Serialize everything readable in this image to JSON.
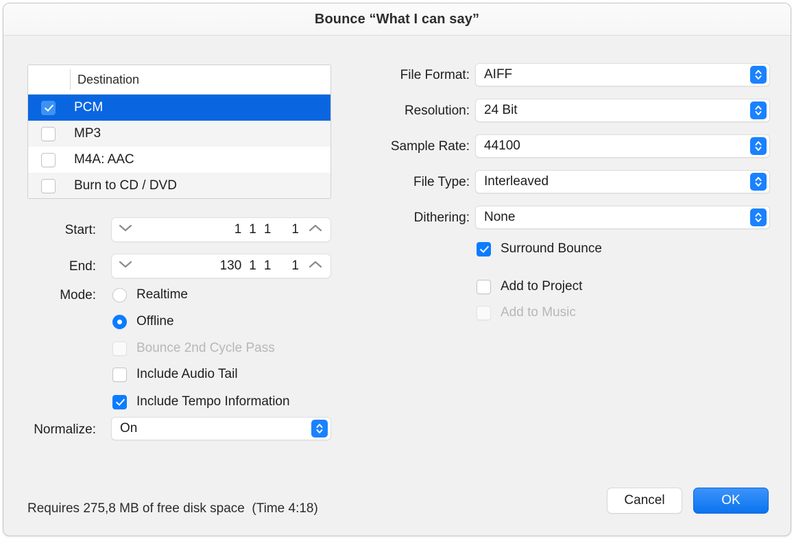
{
  "window": {
    "title": "Bounce “What I can say”"
  },
  "destination": {
    "column_header": "Destination",
    "items": [
      {
        "label": "PCM",
        "checked": true,
        "selected": true
      },
      {
        "label": "MP3",
        "checked": false,
        "selected": false
      },
      {
        "label": "M4A: AAC",
        "checked": false,
        "selected": false
      },
      {
        "label": "Burn to CD / DVD",
        "checked": false,
        "selected": false
      }
    ]
  },
  "range": {
    "start_label": "Start:",
    "start_values": [
      "1",
      "1",
      "1",
      "1"
    ],
    "end_label": "End:",
    "end_values": [
      "130",
      "1",
      "1",
      "1"
    ]
  },
  "mode": {
    "label": "Mode:",
    "options": [
      {
        "label": "Realtime",
        "selected": false
      },
      {
        "label": "Offline",
        "selected": true
      }
    ],
    "checkboxes": [
      {
        "label": "Bounce 2nd Cycle Pass",
        "checked": false,
        "disabled": true
      },
      {
        "label": "Include Audio Tail",
        "checked": false,
        "disabled": false
      },
      {
        "label": "Include Tempo Information",
        "checked": true,
        "disabled": false
      }
    ]
  },
  "normalize": {
    "label": "Normalize:",
    "value": "On"
  },
  "settings": [
    {
      "label": "File Format:",
      "value": "AIFF"
    },
    {
      "label": "Resolution:",
      "value": "24 Bit"
    },
    {
      "label": "Sample Rate:",
      "value": "44100"
    },
    {
      "label": "File Type:",
      "value": "Interleaved"
    },
    {
      "label": "Dithering:",
      "value": "None"
    }
  ],
  "right_checkboxes": [
    {
      "label": "Surround Bounce",
      "checked": true,
      "disabled": false
    },
    {
      "label": "Add to Project",
      "checked": false,
      "disabled": false
    },
    {
      "label": "Add to Music",
      "checked": false,
      "disabled": true
    }
  ],
  "footer": {
    "status": "Requires 275,8 MB of free disk space  (Time 4:18)",
    "cancel_label": "Cancel",
    "ok_label": "OK"
  },
  "colors": {
    "accent": "#0a7cff",
    "selection": "#0a66e0",
    "window_bg": "#f1f1f1"
  }
}
